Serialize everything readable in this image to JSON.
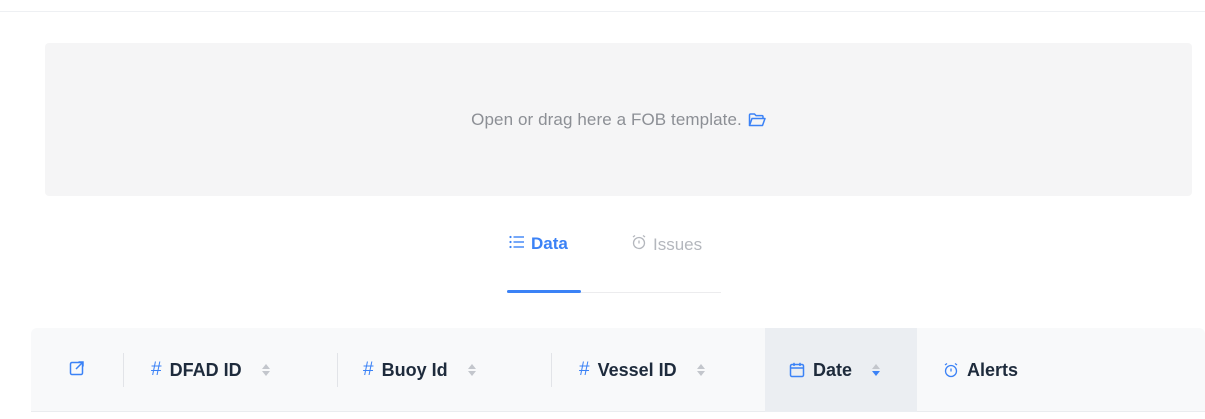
{
  "dropzone": {
    "text": "Open or drag here a FOB template.",
    "icon": "folder-open-icon"
  },
  "tabs": [
    {
      "label": "Data",
      "icon": "list-icon",
      "active": true
    },
    {
      "label": "Issues",
      "icon": "alarm-clock-icon",
      "active": false
    }
  ],
  "table": {
    "columns": [
      {
        "label": "",
        "icon": "external-link-icon"
      },
      {
        "label": "DFAD ID",
        "icon": "hash-icon",
        "sortable": true
      },
      {
        "label": "Buoy Id",
        "icon": "hash-icon",
        "sortable": true
      },
      {
        "label": "Vessel ID",
        "icon": "hash-icon",
        "sortable": true
      },
      {
        "label": "Date",
        "icon": "calendar-icon",
        "sortable": true,
        "sorted": "desc"
      },
      {
        "label": "Alerts",
        "icon": "alarm-clock-icon",
        "sortable": false
      }
    ]
  },
  "colors": {
    "accent": "#3b82f6",
    "muted": "#b4b7bd",
    "dropzone_bg": "#f5f5f6",
    "header_bg": "#f8f9fa",
    "sorted_bg": "#ebeef2"
  }
}
